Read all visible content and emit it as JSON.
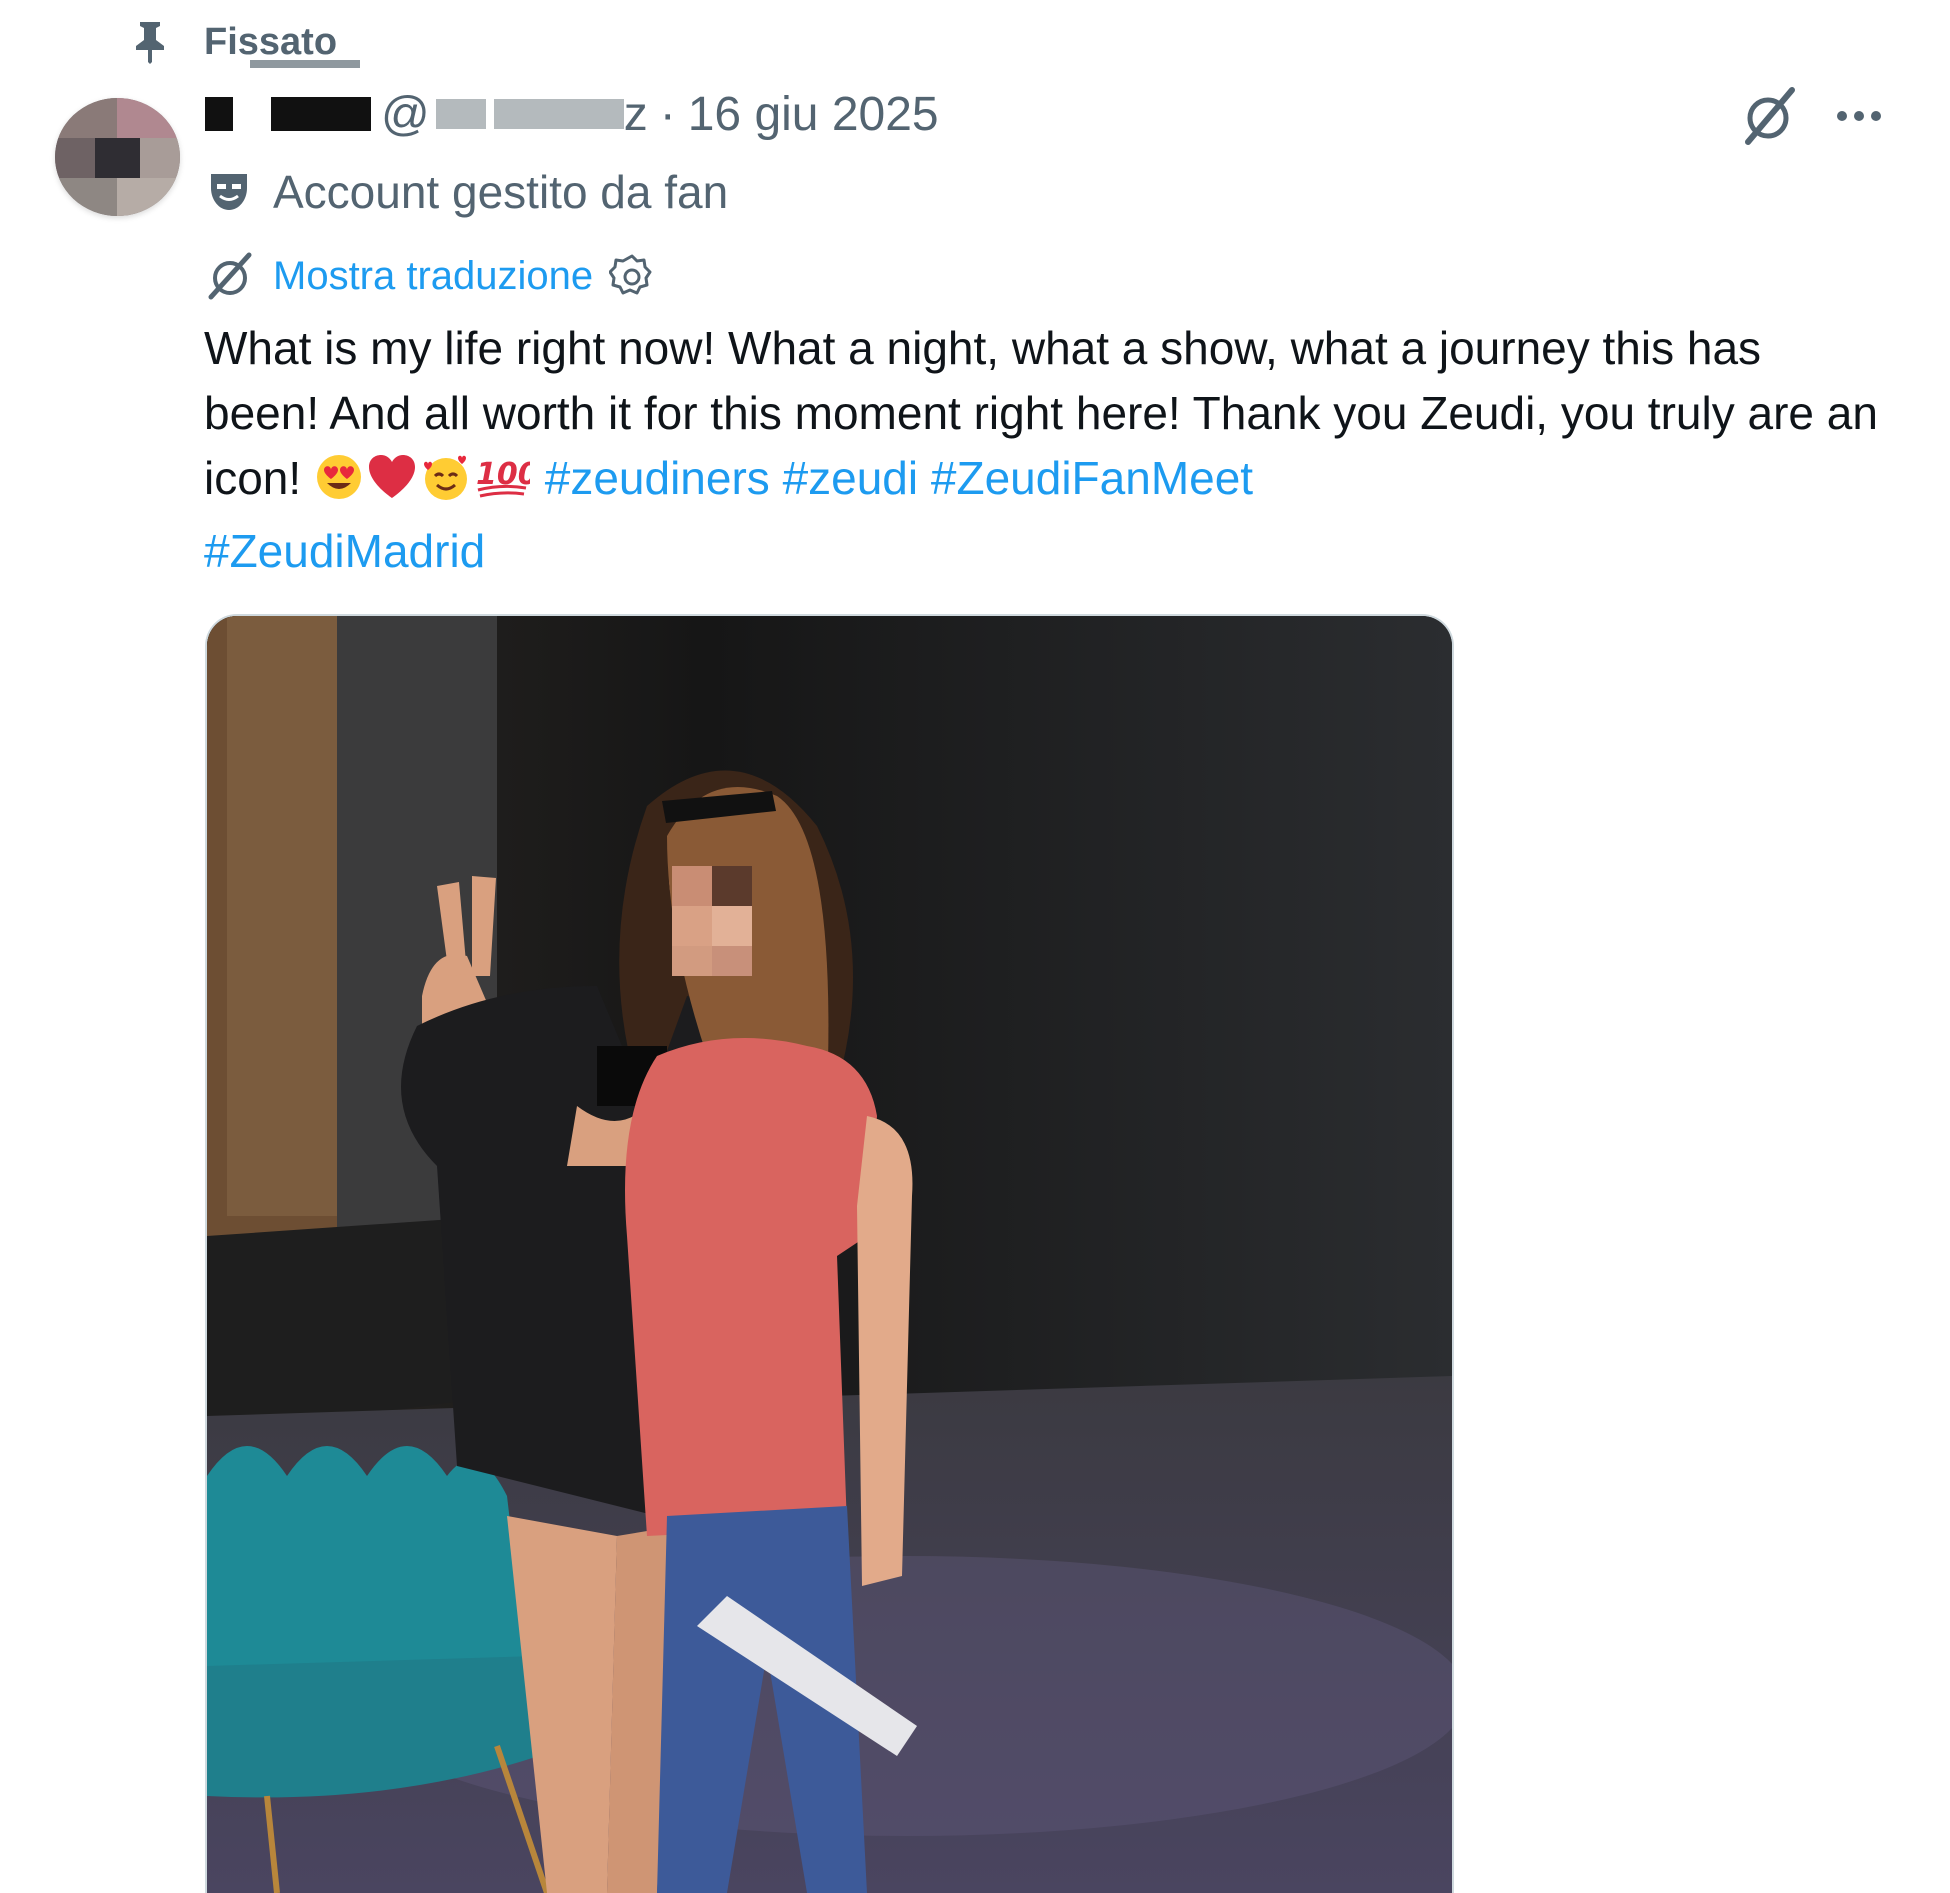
{
  "pinned": {
    "label": "Fissato",
    "icon": "pin-icon"
  },
  "author": {
    "handle_prefix": "@",
    "handle_suffix": "z",
    "separator": "·",
    "date": "16 giu 2025",
    "avatar_icon": "avatar"
  },
  "actions": {
    "grok_icon": "grok-icon",
    "more_icon": "more-icon"
  },
  "fan_account": {
    "label": "Account gestito da fan",
    "icon": "fan-mask-icon"
  },
  "translation": {
    "label": "Mostra traduzione",
    "icon": "translate-icon",
    "settings_icon": "gear-icon"
  },
  "tweet": {
    "text": "What is my life right now! What a night, what a show, what a journey this has been! And all worth it for this moment right here! Thank you Zeudi, you truly are an icon!",
    "emojis": [
      "heart-eyes-emoji",
      "red-heart-emoji",
      "smiling-face-with-hearts-emoji",
      "hundred-points-emoji"
    ],
    "hashtags": [
      "#zeudiners",
      "#zeudi",
      "#ZeudiFanMeet",
      "#ZeudiMadrid"
    ]
  },
  "colors": {
    "link": "#1d9bf0",
    "secondary": "#536471",
    "text": "#0f1419"
  },
  "media": {
    "type": "photo",
    "icon": "photo-image"
  }
}
